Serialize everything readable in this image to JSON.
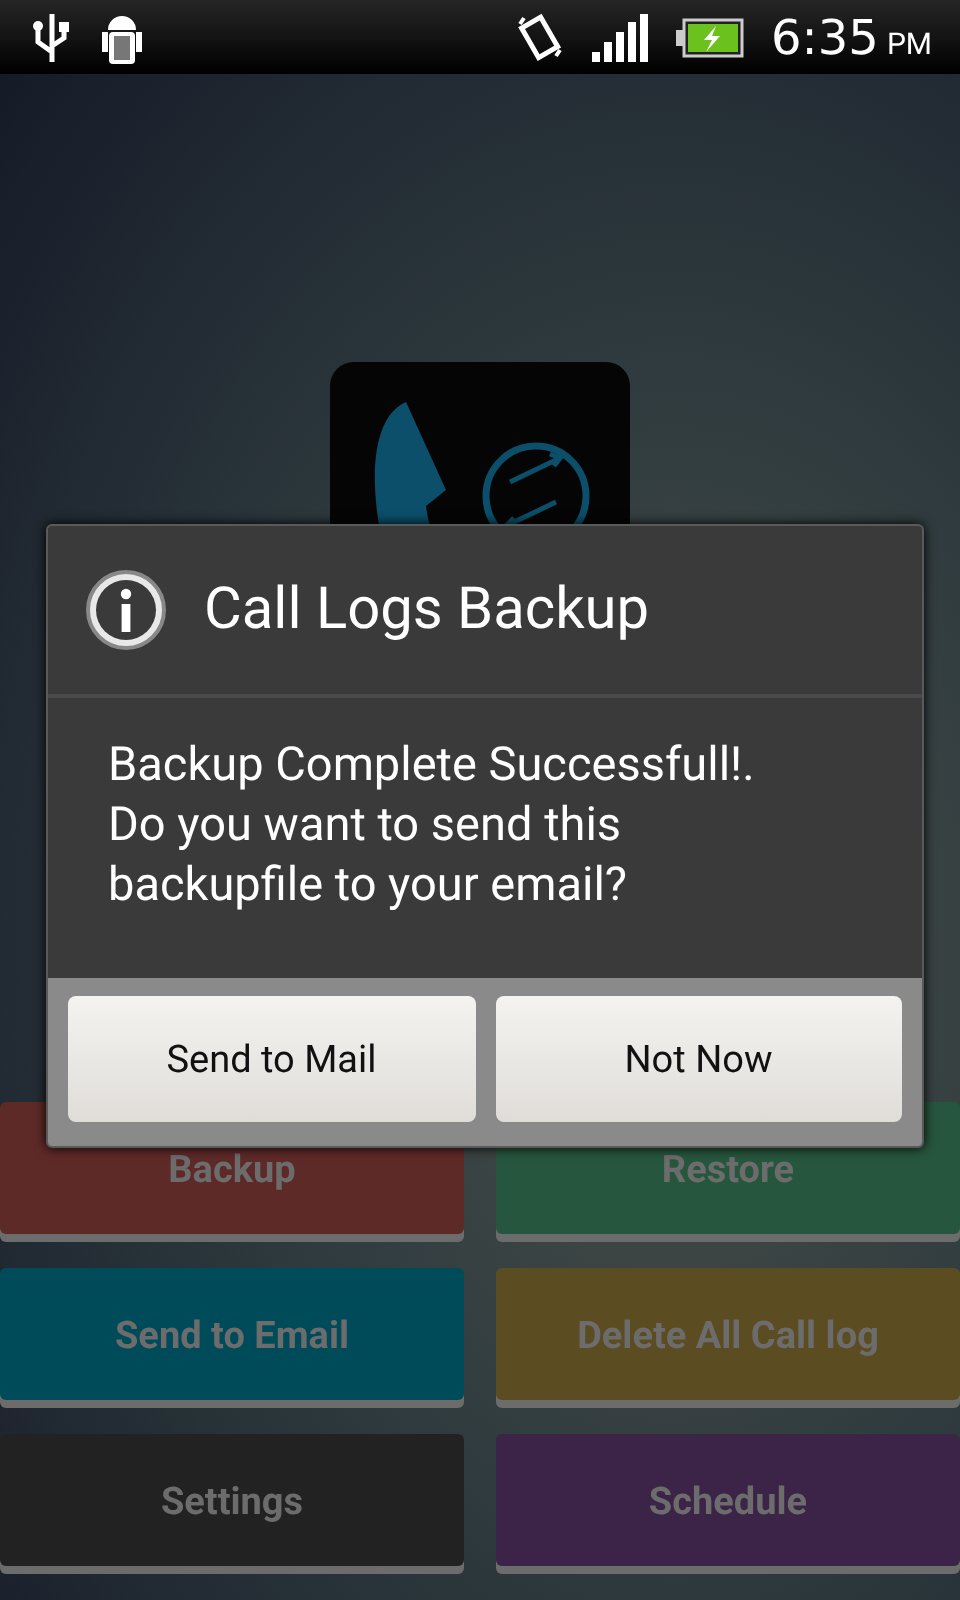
{
  "status_bar": {
    "time": "6:35",
    "meridiem": "PM"
  },
  "dialog": {
    "title": "Call Logs Backup",
    "message": "Backup Complete Successfull!. Do you want to send this backupfile to your email?",
    "buttons": [
      "Send to Mail",
      "Not Now"
    ]
  },
  "tiles": [
    {
      "label": "Backup",
      "color": "#5e2a28"
    },
    {
      "label": "Restore",
      "color": "#27563e"
    },
    {
      "label": "Send to Email",
      "color": "#004b5a"
    },
    {
      "label": "Delete All Call log",
      "color": "#5c4c22"
    },
    {
      "label": "Settings",
      "color": "#222222"
    },
    {
      "label": "Schedule",
      "color": "#3c2448"
    }
  ]
}
